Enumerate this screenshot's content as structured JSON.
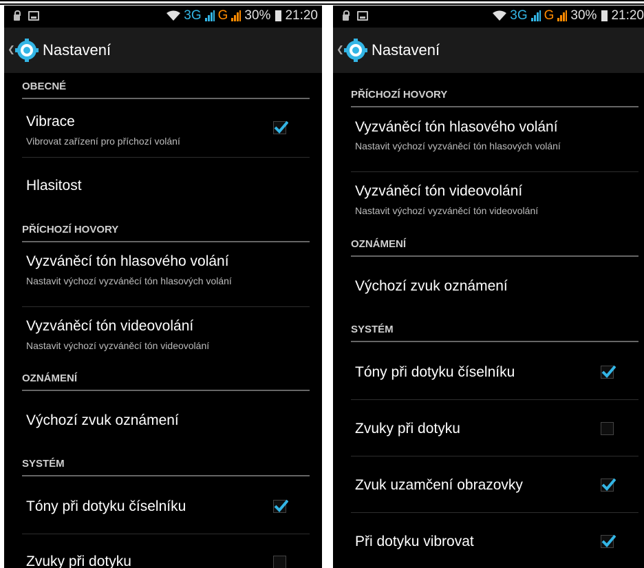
{
  "status_bar": {
    "network_3g": "3G",
    "network_g": "G",
    "battery": "30%",
    "time": "21:20"
  },
  "header": {
    "title": "Nastavení"
  },
  "sections": {
    "general": "OBECNÉ",
    "incoming_calls": "PŘÍCHOZÍ HOVORY",
    "notifications": "OZNÁMENÍ",
    "system": "SYSTÉM"
  },
  "items": {
    "vibration": {
      "title": "Vibrace",
      "summary": "Vibrovat zařízení pro příchozí volání",
      "checked": true
    },
    "volume": {
      "title": "Hlasitost"
    },
    "voice_ringtone": {
      "title": "Vyzváněcí tón hlasového volání",
      "summary": "Nastavit výchozí vyzváněcí tón hlasových volání"
    },
    "video_ringtone": {
      "title": "Vyzváněcí tón videovolání",
      "summary": "Nastavit výchozí vyzváněcí tón videovolání"
    },
    "notification_sound": {
      "title": "Výchozí zvuk oznámení"
    },
    "dialpad_tones": {
      "title": "Tóny při dotyku číselníku",
      "checked": true
    },
    "touch_sounds": {
      "title": "Zvuky při dotyku",
      "checked": false
    },
    "screen_lock_sound": {
      "title": "Zvuk uzamčení obrazovky",
      "checked": true
    },
    "vibrate_on_touch": {
      "title": "Při dotyku vibrovat",
      "checked": true
    }
  },
  "colors": {
    "accent": "#33b5e5",
    "orange": "#ff8a00",
    "background": "#000000",
    "actionbar": "#1b1b1b"
  }
}
